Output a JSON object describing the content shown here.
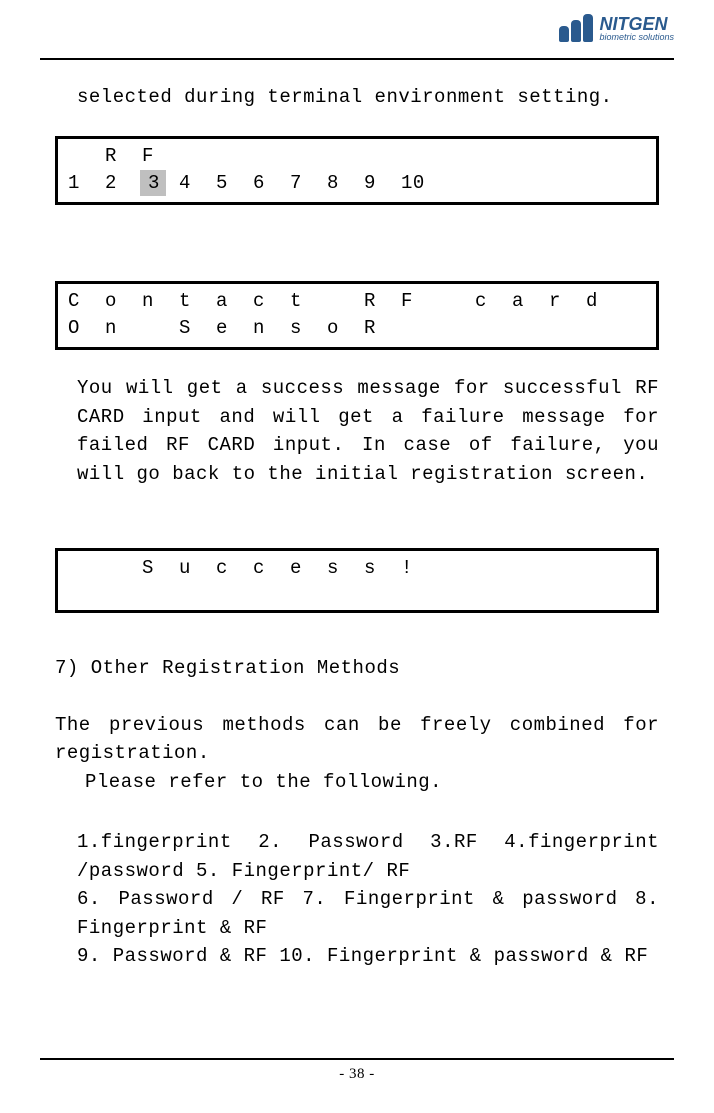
{
  "logo": {
    "title": "NITGEN",
    "subtitle": "biometric solutions"
  },
  "intro": "selected during terminal environment setting.",
  "lcd1": {
    "row1": [
      "",
      "R",
      "F",
      "",
      "",
      "",
      "",
      "",
      "",
      ""
    ],
    "row2": [
      "1",
      "2",
      "3",
      "4",
      "5",
      "6",
      "7",
      "8",
      "9",
      "10"
    ],
    "highlightIndex": 2
  },
  "lcd2": {
    "row1": [
      "C",
      "o",
      "n",
      "t",
      "a",
      "c",
      "t",
      "",
      "R",
      "F",
      "",
      "c",
      "a",
      "r",
      "d"
    ],
    "row2": [
      "O",
      "n",
      "",
      "S",
      "e",
      "n",
      "s",
      "o",
      "R",
      "",
      "",
      "",
      "",
      "",
      ""
    ]
  },
  "para": "You will get a success message for successful RF CARD input and will get a failure message for failed RF CARD input. In case of failure, you will go back to the initial registration screen.",
  "lcd3": {
    "row1": [
      "",
      "",
      "S",
      "u",
      "c",
      "c",
      "e",
      "s",
      "s",
      "!",
      "",
      "",
      "",
      "",
      ""
    ]
  },
  "sectionTitle": "7) Other Registration Methods",
  "para2a": "The previous methods can be freely combined for registration.",
  "para2b": "Please refer to the following.",
  "para3a": "1.fingerprint 2. Password 3.RF  4.fingerprint /password 5. Fingerprint/ RF",
  "para3b": "6. Password / RF 7. Fingerprint & password 8. Fingerprint & RF",
  "para3c": "9. Password & RF 10. Fingerprint & password & RF",
  "pageNumber": "- 38 -"
}
